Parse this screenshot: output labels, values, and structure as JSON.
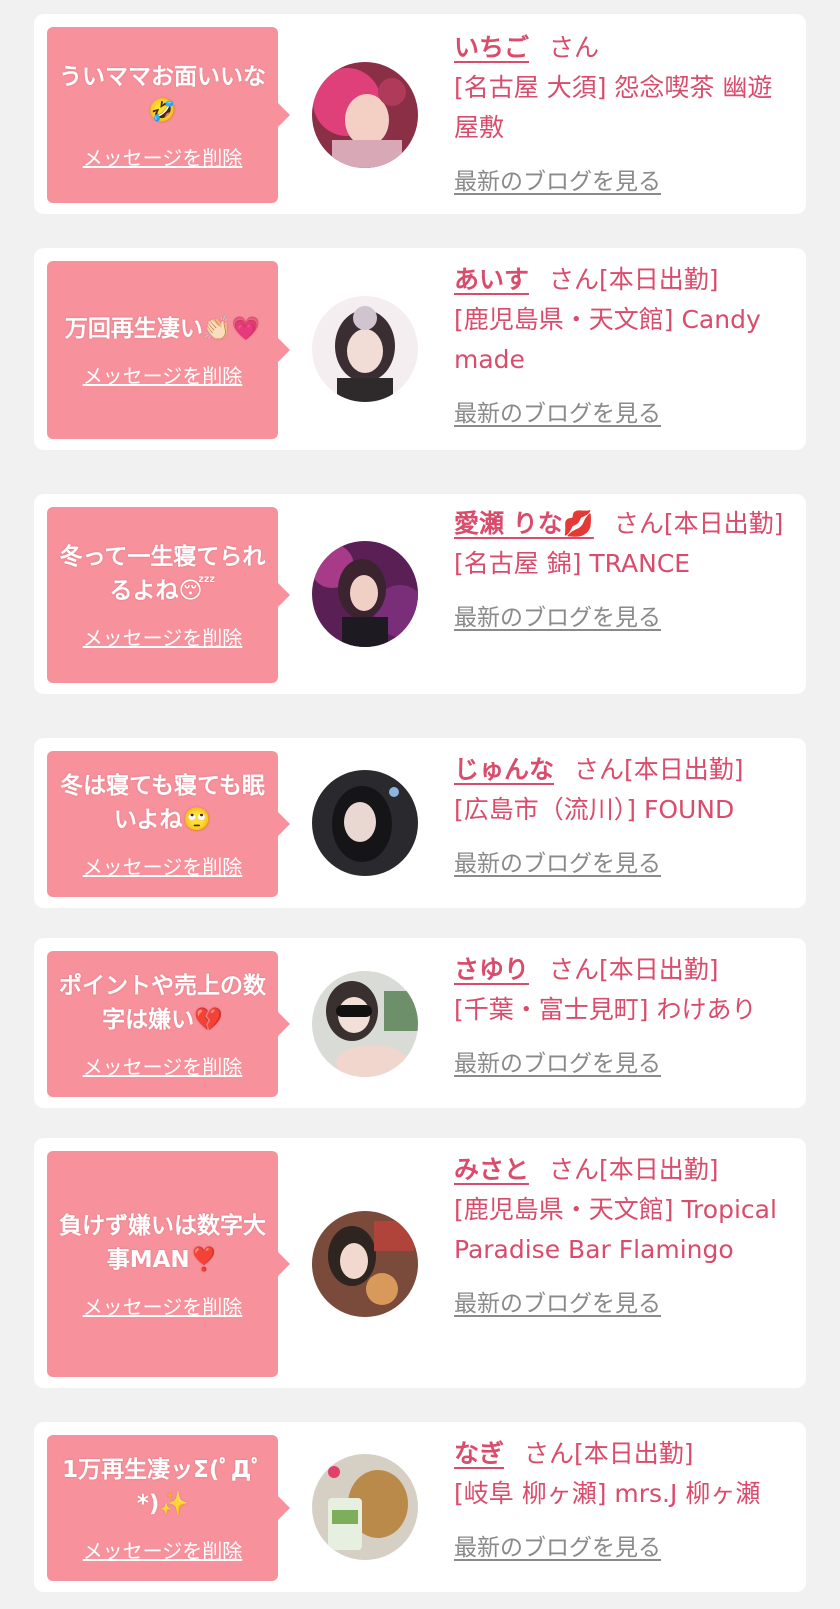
{
  "colors": {
    "page_bg": "#f1f1f1",
    "card_bg": "#ffffff",
    "bubble": "#f7929c",
    "accent": "#d94c6c",
    "link_gray": "#8a8a8a"
  },
  "entries": [
    {
      "message": "ういママお面いいな🤣",
      "delete_label": "メッセージを削除",
      "name": "いちご",
      "honorific": "さん",
      "status": "",
      "shop": "[名古屋 大須] 怨念喫茶 幽遊屋敷",
      "blog_label": "最新のブログを見る",
      "avatar_icon": "profile-photo-pink-hair"
    },
    {
      "message": "万回再生凄い👏🏻💗",
      "delete_label": "メッセージを削除",
      "name": "あいす",
      "honorific": "さん",
      "status": "[本日出勤]",
      "shop": "[鹿児島県・天文館] Candy made",
      "blog_label": "最新のブログを見る",
      "avatar_icon": "profile-photo-dark-hair"
    },
    {
      "message": "冬って一生寝てられるよね😴",
      "delete_label": "メッセージを削除",
      "name": "愛瀬 りな💋",
      "honorific": "さん",
      "status": "[本日出勤]",
      "shop": "[名古屋 錦] TRANCE",
      "blog_label": "最新のブログを見る",
      "avatar_icon": "profile-photo-purple"
    },
    {
      "message": "冬は寝ても寝ても眠いよね🙄",
      "delete_label": "メッセージを削除",
      "name": "じゅんな",
      "honorific": "さん",
      "status": "[本日出勤]",
      "shop": "[広島市（流川）] FOUND",
      "blog_label": "最新のブログを見る",
      "avatar_icon": "profile-photo-dark"
    },
    {
      "message": "ポイントや売上の数字は嫌い💔",
      "delete_label": "メッセージを削除",
      "name": "さゆり",
      "honorific": "さん",
      "status": "[本日出勤]",
      "shop": "[千葉・富士見町] わけあり",
      "blog_label": "最新のブログを見る",
      "avatar_icon": "profile-photo-sunglasses"
    },
    {
      "message": "負けず嫌いは数字大事MAN❣️",
      "delete_label": "メッセージを削除",
      "name": "みさと",
      "honorific": "さん",
      "status": "[本日出勤]",
      "shop": "[鹿児島県・天文館] Tropical Paradise Bar Flamingo",
      "blog_label": "最新のブログを見る",
      "avatar_icon": "profile-photo-selfie"
    },
    {
      "message": "1万再生凄ッΣ(ﾟДﾟ*)✨",
      "delete_label": "メッセージを削除",
      "name": "なぎ",
      "honorific": "さん",
      "status": "[本日出勤]",
      "shop": "[岐阜 柳ヶ瀬] mrs.J 柳ヶ瀬",
      "blog_label": "最新のブログを見る",
      "avatar_icon": "profile-photo-dog"
    }
  ]
}
